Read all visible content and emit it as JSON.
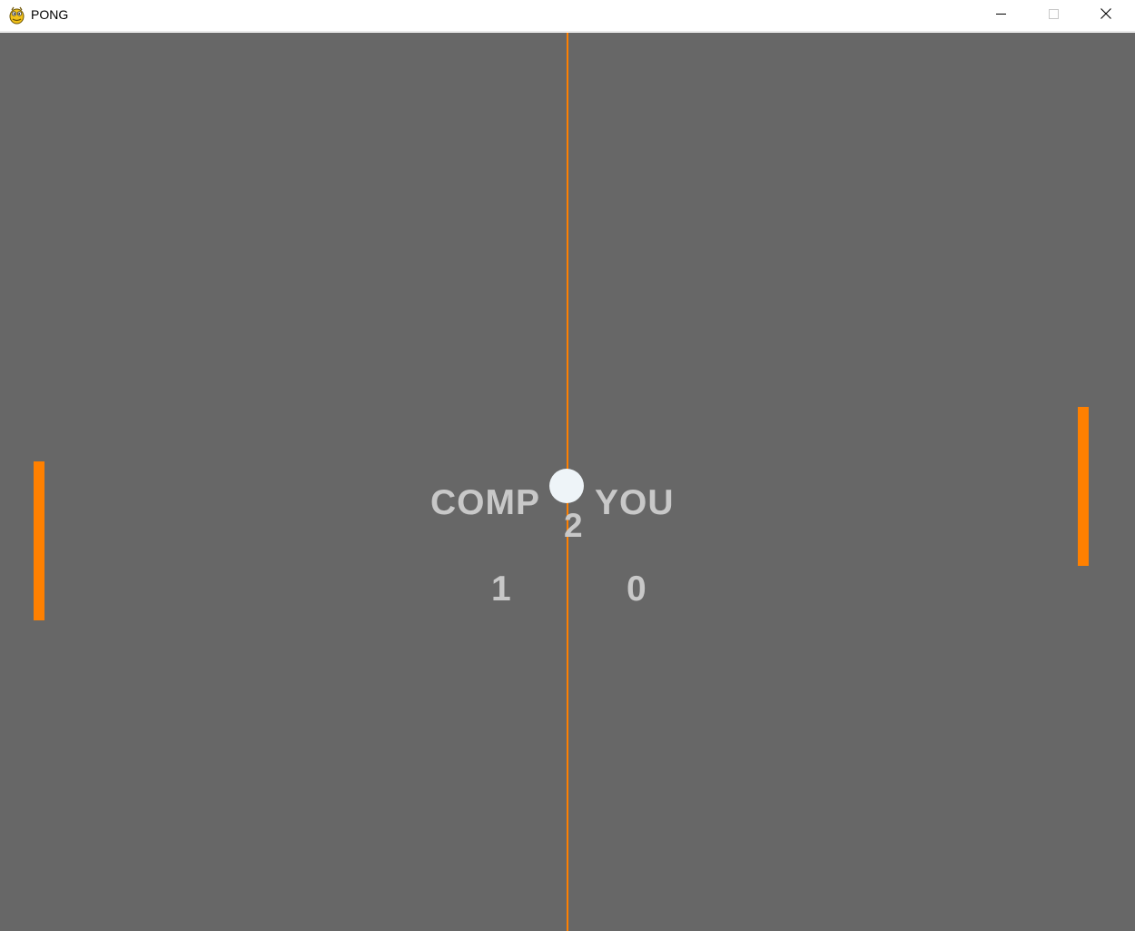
{
  "window": {
    "title": "PONG",
    "app_icon": "pygame-snake-icon",
    "controls": {
      "minimize": "minimize-icon",
      "maximize": "maximize-icon",
      "close": "close-icon"
    }
  },
  "game": {
    "labels": {
      "computer": "COMP",
      "player": "YOU"
    },
    "rally": "2",
    "scores": {
      "computer": "1",
      "player": "0"
    }
  },
  "colors": {
    "background": "#676767",
    "paddle": "#ff8000",
    "net": "#ff8000",
    "ball": "#eef4f8",
    "text": "#c8c8c8",
    "titlebar": "#ffffff"
  }
}
